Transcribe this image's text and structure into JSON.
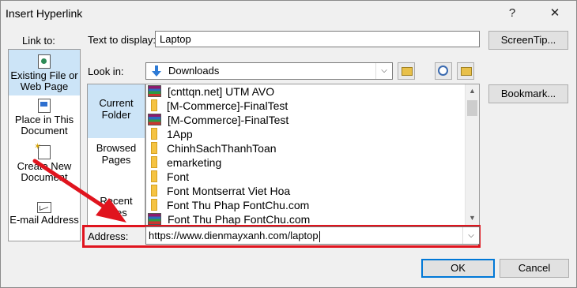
{
  "window": {
    "title": "Insert Hyperlink",
    "help_glyph": "?",
    "close_glyph": "✕"
  },
  "link_to": {
    "label": "Link to:",
    "items": [
      {
        "line1": "Existing File or",
        "line2": "Web Page",
        "icon": "globe-document-icon",
        "selected": true
      },
      {
        "line1": "Place in This",
        "line2": "Document",
        "icon": "bookmark-document-icon",
        "selected": false
      },
      {
        "line1": "Create New",
        "line2": "Document",
        "icon": "new-document-icon",
        "selected": false
      },
      {
        "line1": "E-mail Address",
        "line2": "",
        "icon": "envelope-icon",
        "selected": false
      }
    ]
  },
  "text_to_display": {
    "label": "Text to display:",
    "value": "Laptop"
  },
  "look_in": {
    "label": "Look in:",
    "value": "Downloads"
  },
  "nav": {
    "items": [
      {
        "line1": "Current",
        "line2": "Folder",
        "selected": true
      },
      {
        "line1": "Browsed",
        "line2": "Pages",
        "selected": false
      },
      {
        "line1": "Recent Files",
        "line2": "",
        "selected": false
      }
    ]
  },
  "files": [
    {
      "name": "[cnttqn.net] UTM AVO",
      "type": "archive"
    },
    {
      "name": "[M-Commerce]-FinalTest",
      "type": "folder"
    },
    {
      "name": "[M-Commerce]-FinalTest",
      "type": "archive"
    },
    {
      "name": "1App",
      "type": "folder"
    },
    {
      "name": "ChinhSachThanhToan",
      "type": "folder"
    },
    {
      "name": "emarketing",
      "type": "folder"
    },
    {
      "name": "Font",
      "type": "folder"
    },
    {
      "name": "Font Montserrat Viet Hoa",
      "type": "folder"
    },
    {
      "name": "Font Thu Phap FontChu.com",
      "type": "folder"
    },
    {
      "name": "Font Thu Phap FontChu.com",
      "type": "archive"
    }
  ],
  "address": {
    "label": "Address:",
    "value": "https://www.dienmayxanh.com/laptop"
  },
  "buttons": {
    "screentip": "ScreenTip...",
    "bookmark": "Bookmark...",
    "ok": "OK",
    "cancel": "Cancel"
  },
  "colors": {
    "accent": "#0078d7",
    "selection": "#cce4f7",
    "highlight_frame": "#e0141e",
    "arrow": "#e0141e"
  }
}
